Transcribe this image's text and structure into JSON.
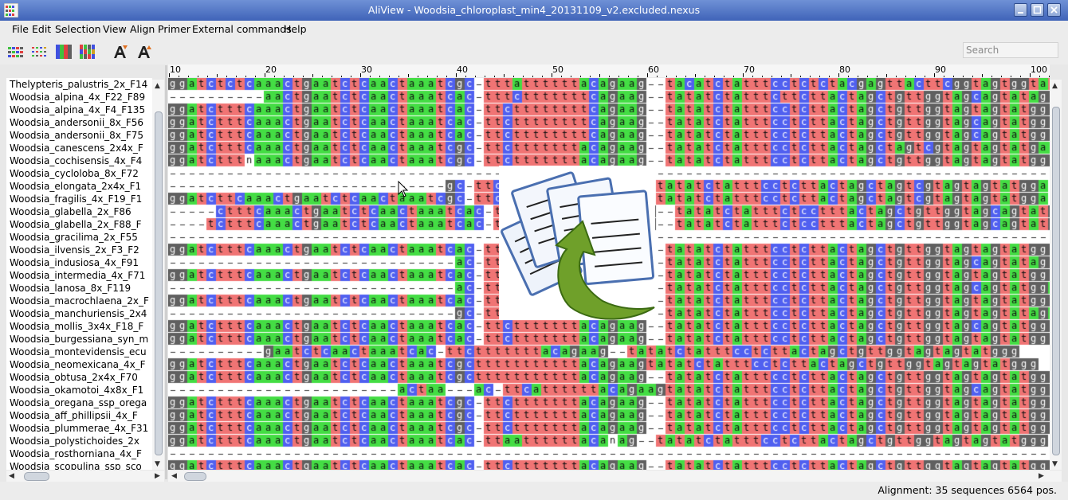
{
  "window": {
    "title": "AliView - Woodsia_chloroplast_min4_20131109_v2.excluded.nexus"
  },
  "menu": [
    "File",
    "Edit",
    "Selection",
    "View",
    "Align",
    "Primer",
    "External commands",
    "Help"
  ],
  "toolbar": {
    "buttons": [
      "consensus-view-icon",
      "translate-view-icon",
      "nucleotide-color-icon",
      "color-bars-icon",
      "font-increase-icon",
      "font-decrease-icon"
    ],
    "search_placeholder": "Search"
  },
  "ruler": {
    "ticks": [
      "10",
      "20",
      "30",
      "40",
      "50",
      "60",
      "70",
      "80",
      "90",
      "100"
    ]
  },
  "sequences": [
    {
      "name": "Thelypteris_palustris_2x_F14",
      "seq": "ggatctctcaaactgaatctcaactaaatcgc-tttattttttacagaag--tacatctatttcctctctacgagttacttcggtagtggtatggg"
    },
    {
      "name": "Woodsia_alpina_4x_F22_F89",
      "seq": "----------aactgaatctcaactaaatcac-tttctttttttcagaag--tatatctatttcttcttactagctgttggtagcagtatagg"
    },
    {
      "name": "Woodsia_alpina_4x_F4_F135",
      "seq": "ggatctttcaaactgaatctcaactaaatcac-ttcttttttttcagaag--tatatctatttcctcttactagctgttggtagtagtatggg"
    },
    {
      "name": "Woodsia_andersonii_8x_F56",
      "seq": "ggatctttcaaactgaatctcaactaaatcac-ttcttttttttcagaag--tatatctatttcctcttactagctgttggtagcagtatggg"
    },
    {
      "name": "Woodsia_andersonii_8x_F75",
      "seq": "ggatctttcaaactgaatctcaactaaatcac-ttcttttttttcagaag--tatatctatttcctcttactagctgttggtagcagtatggg"
    },
    {
      "name": "Woodsia_canescens_2x4x_F",
      "seq": "ggatctttcaaactgaatctcaactaaatcgc-ttctttttttacagaag--tatatctatttcctcttactagctagtcgtagtagtatgaa"
    },
    {
      "name": "Woodsia_cochisensis_4x_F4",
      "seq": "ggatctttnaaactgaatctcaactaaatcgc-ttctttttttacagaag--tatatctatttcctcttactagctgttggtagtagtatggg"
    },
    {
      "name": "Woodsia_cycloloba_8x_F72",
      "seq": "--------------------------------------------------------------------------------------------"
    },
    {
      "name": "Woodsia_elongata_2x4x_F1",
      "seq": "-----------------------------gc-ttctttttttacagaag--tatatctatttcctcttactagctagtcgtagtagtatgga"
    },
    {
      "name": "Woodsia_fragilis_4x_F19_F1",
      "seq": "ggatcttcaaactgaatctcaactaaatcgc-ttctttttttacagaag--tatatctatttcctcttactagctagtcgtagtagtatgga"
    },
    {
      "name": "Woodsia_glabella_2x_F86",
      "seq": "-----ctttcaaactgaatctcaactaaatcac-ttctttttttacagaag--tatatctatttctcctttactagctgttggtagcagtatgga"
    },
    {
      "name": "Woodsia_glabella_2x_F88_F",
      "seq": "----tctttcaaactgaatctcaactaaatcac-ttctttttttacagaag--tatatctatttctcctttactagctgttggtagcagtatggg"
    },
    {
      "name": "Woodsia_gracilima_2x_F55",
      "seq": "--------------------------------------------------------------------------------------------"
    },
    {
      "name": "Woodsia_ilvensis_2x_F3_F2",
      "seq": "ggatctttcaaactgaatctcaactaaatcac-ttctttttttacagaag--tatatctatttcctcttactagctgttggtagtagtatggg"
    },
    {
      "name": "Woodsia_indusiosa_4x_F91",
      "seq": "------------------------------ac-ttctttttttacagaag--tatatctatttcctcttactagctgttggtagcagtatagg"
    },
    {
      "name": "Woodsia_intermedia_4x_F71",
      "seq": "ggatctttcaaactgaatctcaactaaatcac-ttctttttttacagaag--tatatctatttcctcttactagctgttggtagtagtatggg"
    },
    {
      "name": "Woodsia_lanosa_8x_F119",
      "seq": "------------------------------ac-ttctttttttacagaag--tatatctatttcctcttactagctgttggtagcagtatgga"
    },
    {
      "name": "Woodsia_macrochlaena_2x_F",
      "seq": "ggatctttcaaactgaatctcaactaaatcac-ttctttttttacagaag--tatatctatttcctcttactagctgttggtagtagtatggg"
    },
    {
      "name": "Woodsia_manchuriensis_2x4",
      "seq": "------------------------------gc-ttctttttttacagaag--tatatctatttcctcttactagctgttggtagtagtataga"
    },
    {
      "name": "Woodsia_mollis_3x4x_F18_F",
      "seq": "ggatctttcaaactgaatctcaactaaatcac-ttctttttttacagaag--tatatctatttcctcttactagctgttggtagcagtatggg"
    },
    {
      "name": "Woodsia_burgessiana_syn_m",
      "seq": "ggatctttcaaactgaatctcaactaaatcac-ttctttttttacagaag--tatatctatttcctcttactagctgttggtagtagtatggg"
    },
    {
      "name": "Woodsia_montevidensis_ecu",
      "seq": "----------gaatctcaactaaatcac-ttctttttttacagaag--tatatctatttcctcttactagctgttggtagtagtatggg"
    },
    {
      "name": "Woodsia_neomexicana_4x_F",
      "seq": "ggatctttcaaactgaatctcaactaaatcgctttttttttttacagaagtatatctatttcctcttactagctgttggtagtagtatggg"
    },
    {
      "name": "Woodsia_obtusa_2x4x_F70",
      "seq": "ggatctttcaaactgaatctcaactaaatcgctttttttttttacagaag--tatatctatttcctcttactagctgttggtagtagtatggg"
    },
    {
      "name": "Woodsia_okamotoi_4x8x_F1",
      "seq": "------------------------actaa---ac-ttcattttttacagaagtatatctatttcctcttactagctgttggtagcagtatggg"
    },
    {
      "name": "Woodsia_oregana_ssp_orega",
      "seq": "ggatctttcaaactgaatctcaactaaatcgc-ttctttttttacagaag--tatatctatttcctcttactagctgttggtagtagtatggg"
    },
    {
      "name": "Woodsia_aff_phillipsii_4x_F",
      "seq": "ggatctttcaaactgaatctcaactaaatcgc-ttctttttttacagaag--tatatctatttcctcttactagctgttggtagtagtatggg"
    },
    {
      "name": "Woodsia_plummerae_4x_F31",
      "seq": "ggatctttcaaactgaatctcaactaaatcgc-ttctttttttacagaag--tatatctatttcctcttactagctgttggtagtagtatggg"
    },
    {
      "name": "Woodsia_polystichoides_2x",
      "seq": "ggatctttcaaactgaatctcaactaaatcac-ttaattttttacanag--tatatctatttcctcttactagctgttggtagtagtatggg"
    },
    {
      "name": "Woodsia_rosthorniana_4x_F",
      "seq": "--------------------------------------------------------------------------------------------"
    },
    {
      "name": "Woodsia_scopulina_ssp_sco",
      "seq": "ggatctttcaaactgaatctcaactaaatcac-ttctttttttacagaag--tatatctatttcctcttactagctgttggtagtagtatggg"
    }
  ],
  "colors": {
    "a": "#44dd44",
    "c": "#5060f0",
    "g": "#606060",
    "t": "#f07474",
    "gap": "#ffffff",
    "n": "#ffffff"
  },
  "status": {
    "text": "Alignment: 35 sequences    6564 pos."
  }
}
